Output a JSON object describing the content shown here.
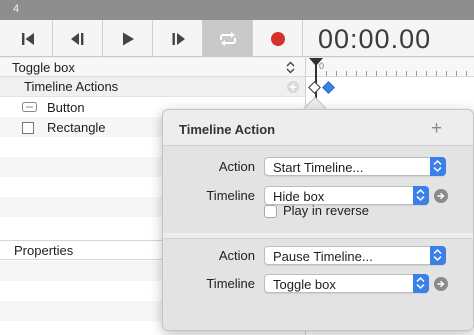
{
  "window": {
    "title_fragment": "4"
  },
  "toolbar": {
    "buttons": [
      {
        "name": "skip-to-start",
        "icon": "skip-to-start-icon"
      },
      {
        "name": "step-back",
        "icon": "step-back-icon"
      },
      {
        "name": "play",
        "icon": "play-icon"
      },
      {
        "name": "step-forward",
        "icon": "step-forward-icon"
      },
      {
        "name": "loop",
        "icon": "loop-icon",
        "active": true
      },
      {
        "name": "record",
        "icon": "record-icon",
        "color": "#d7312a"
      }
    ],
    "timecode": "00:00.00"
  },
  "outline": {
    "timeline_selector": "Toggle box",
    "timeline_actions_label": "Timeline Actions",
    "items": [
      {
        "label": "Button",
        "icon": "button-icon"
      },
      {
        "label": "Rectangle",
        "icon": "rectangle-icon"
      }
    ],
    "properties_label": "Properties"
  },
  "ruler": {
    "zero_label": "0"
  },
  "popover": {
    "title": "Timeline Action",
    "actions": [
      {
        "action_label": "Action",
        "action_value": "Start Timeline...",
        "timeline_label": "Timeline",
        "timeline_value": "Hide box",
        "checkbox_label": "Play in reverse",
        "checkbox_checked": false
      },
      {
        "action_label": "Action",
        "action_value": "Pause Timeline...",
        "timeline_label": "Timeline",
        "timeline_value": "Toggle box"
      }
    ]
  },
  "colors": {
    "accent": "#3a80e8",
    "record": "#d7312a",
    "keyframe": "#3a80e8"
  }
}
